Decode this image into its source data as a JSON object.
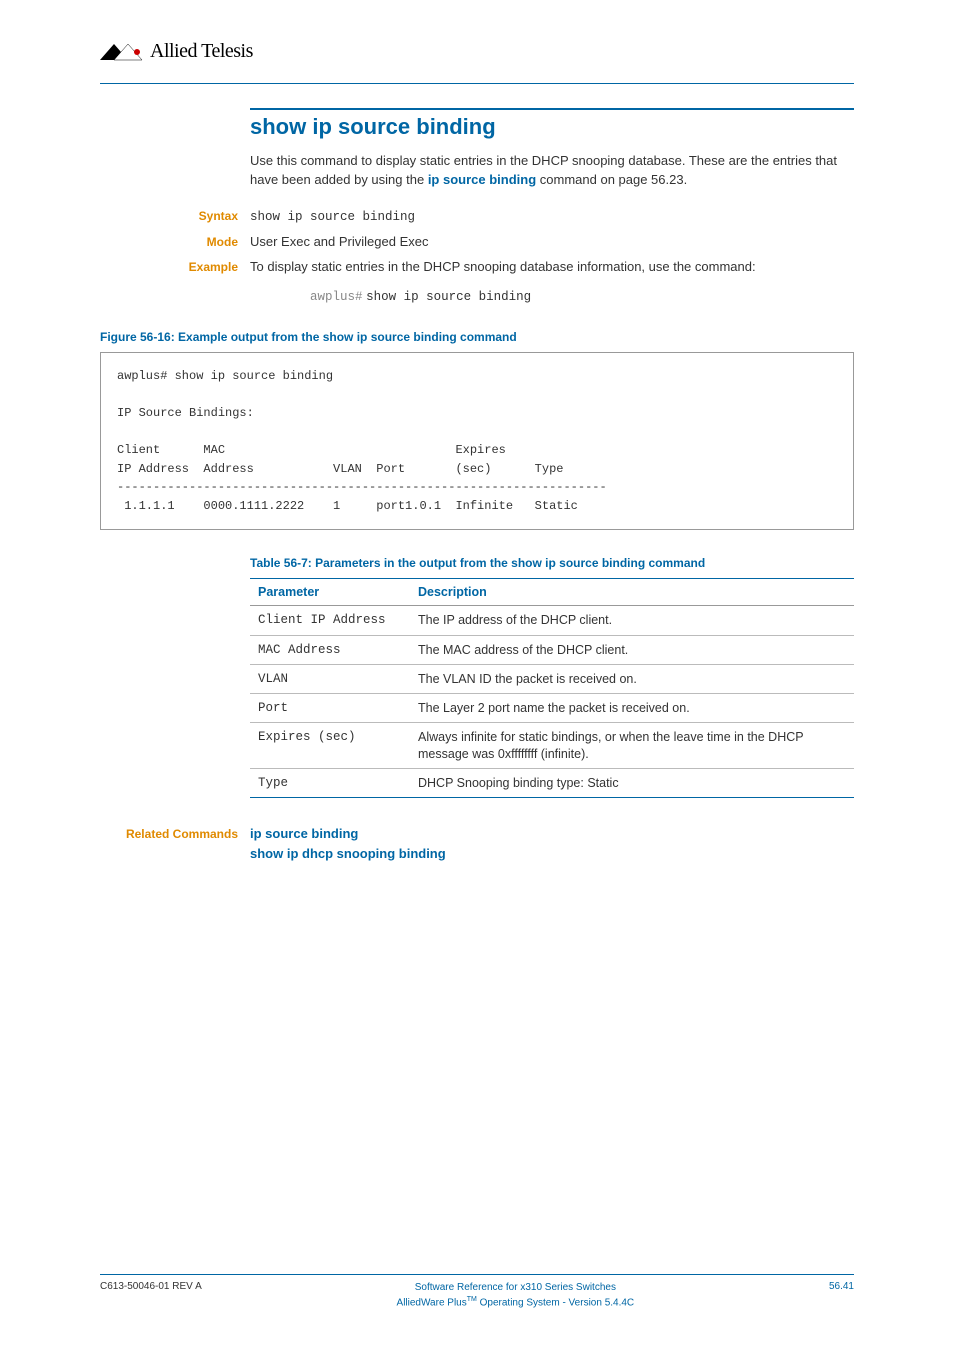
{
  "header": {
    "logo_text": "Allied Telesis"
  },
  "title": "show ip source binding",
  "intro_before_link": "Use this command to display static entries in the DHCP snooping database. These are the entries that have been added by using the ",
  "intro_link": "ip source binding",
  "intro_after_link": " command on page 56.23.",
  "syntax": {
    "label": "Syntax",
    "value": "show ip source binding"
  },
  "mode": {
    "label": "Mode",
    "value": "User Exec and Privileged Exec"
  },
  "example": {
    "label": "Example",
    "text": "To display static entries in the DHCP snooping database information, use the command:",
    "prompt": "awplus#",
    "cmd": "show ip source binding"
  },
  "figure": {
    "caption": "Figure 56-16:  Example output from the show ip source binding command",
    "output": "awplus# show ip source binding\n\nIP Source Bindings:\n\nClient      MAC                                Expires\nIP Address  Address           VLAN  Port       (sec)      Type\n--------------------------------------------------------------------\n 1.1.1.1    0000.1111.2222    1     port1.0.1  Infinite   Static"
  },
  "table": {
    "caption": "Table 56-7: Parameters in the output from the show ip source binding command",
    "headers": {
      "param": "Parameter",
      "desc": "Description"
    },
    "rows": [
      {
        "param": "Client IP Address",
        "desc": "The IP address of the DHCP client."
      },
      {
        "param": "MAC Address",
        "desc": "The MAC address of the DHCP client."
      },
      {
        "param": "VLAN",
        "desc": "The VLAN ID the packet is received on."
      },
      {
        "param": "Port",
        "desc": "The Layer 2 port name the packet is received on."
      },
      {
        "param": "Expires (sec)",
        "desc": "Always infinite for static bindings, or when the leave time in the DHCP message was 0xffffffff (infinite)."
      },
      {
        "param": "Type",
        "desc": "DHCP Snooping binding type: Static"
      }
    ]
  },
  "related": {
    "label": "Related Commands",
    "links": [
      "ip source binding",
      "show ip dhcp snooping binding"
    ]
  },
  "footer": {
    "left": "C613-50046-01 REV A",
    "center_line1": "Software Reference for x310 Series Switches",
    "center_line2_before": "AlliedWare Plus",
    "center_line2_tm": "TM",
    "center_line2_after": " Operating System - Version 5.4.4C",
    "right": "56.41"
  }
}
